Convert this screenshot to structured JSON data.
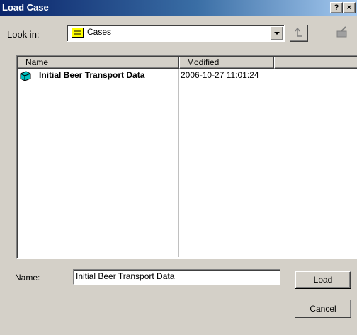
{
  "window": {
    "title": "Load Case",
    "help_label": "?",
    "close_label": "×"
  },
  "look_in": {
    "label": "Look in:",
    "value": "Cases",
    "icon": "folder-icon"
  },
  "toolbar": {
    "up_icon": "up-folder-icon",
    "new_folder_icon": "new-folder-icon"
  },
  "list": {
    "columns": [
      "Name",
      "Modified"
    ],
    "rows": [
      {
        "name": "Initial Beer Transport Data",
        "modified": "2006-10-27 11:01:24",
        "icon": "cube-icon"
      }
    ]
  },
  "name_field": {
    "label": "Name:",
    "value": "Initial Beer Transport Data"
  },
  "buttons": {
    "load": "Load",
    "cancel": "Cancel"
  },
  "colors": {
    "title_gradient_start": "#0a246a",
    "title_gradient_end": "#a6caf0",
    "face": "#d4d0c8",
    "folder": "#ffff00",
    "cube": "#00c0c0"
  }
}
